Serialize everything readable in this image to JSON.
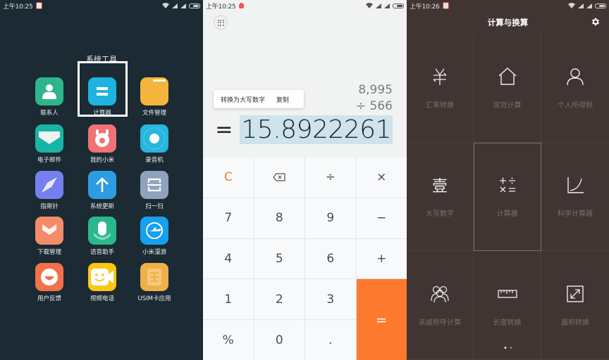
{
  "panel1": {
    "status": {
      "time": "上午10:25"
    },
    "folder_title": "系统工具",
    "apps": [
      {
        "label": "联系人",
        "icon": "contacts-icon",
        "color": "#2fb48d"
      },
      {
        "label": "计算器",
        "icon": "calculator-icon",
        "color": "#1fb3e0"
      },
      {
        "label": "文件管理",
        "icon": "folder-icon",
        "color": "#f3b53c"
      },
      {
        "label": "电子邮件",
        "icon": "email-icon",
        "color": "#18b5a6"
      },
      {
        "label": "我的小米",
        "icon": "mi-bunny-icon",
        "color": "#f07272"
      },
      {
        "label": "录音机",
        "icon": "recorder-icon",
        "color": "#26b6e0"
      },
      {
        "label": "指南针",
        "icon": "compass-icon",
        "color": "#7580f0"
      },
      {
        "label": "系统更新",
        "icon": "update-arrow-icon",
        "color": "#2d9de3"
      },
      {
        "label": "扫一扫",
        "icon": "scan-icon",
        "color": "#8fa3bd"
      },
      {
        "label": "下载管理",
        "icon": "download-icon",
        "color": "#f48c6a"
      },
      {
        "label": "语音助手",
        "icon": "microphone-icon",
        "color": "#29b88c"
      },
      {
        "label": "小米漫游",
        "icon": "plane-roaming-icon",
        "color": "#16a0ef"
      },
      {
        "label": "用户反馈",
        "icon": "feedback-smile-icon",
        "color": "#f2704a"
      },
      {
        "label": "视频电话",
        "icon": "video-call-icon",
        "color": "#fbc714"
      },
      {
        "label": "USIM卡应用",
        "icon": "sim-card-icon",
        "color": "#efb04a"
      }
    ]
  },
  "panel2": {
    "status": {
      "time": "上午10:25"
    },
    "expression": {
      "operand1": "8,995",
      "operator_line": "÷  566"
    },
    "popup": {
      "convert": "转换为大写数字",
      "copy": "复制"
    },
    "result": {
      "eq": "=",
      "value": "15.8922261"
    },
    "keys": [
      "C",
      "⌫",
      "÷",
      "×",
      "7",
      "8",
      "9",
      "−",
      "4",
      "5",
      "6",
      "+",
      "1",
      "2",
      "3",
      "=",
      "%",
      "0",
      "."
    ],
    "accent": "#fd792d"
  },
  "panel3": {
    "status": {
      "time": "上午10:26"
    },
    "title": "计算与换算",
    "tiles": [
      {
        "label": "汇率转换",
        "icon": "currency-exchange-icon"
      },
      {
        "label": "房贷计算",
        "icon": "house-icon"
      },
      {
        "label": "个人所得税",
        "icon": "person-icon"
      },
      {
        "label": "大写数字",
        "icon": "chinese-numeral-icon"
      },
      {
        "label": "计算器",
        "icon": "calculator-ops-icon"
      },
      {
        "label": "科学计算器",
        "icon": "curve-chart-icon"
      },
      {
        "label": "亲戚称呼计算",
        "icon": "family-icon"
      },
      {
        "label": "长度转换",
        "icon": "ruler-icon"
      },
      {
        "label": "面积转换",
        "icon": "resize-arrows-icon"
      }
    ],
    "pager": {
      "current": 1,
      "total": 2
    }
  }
}
